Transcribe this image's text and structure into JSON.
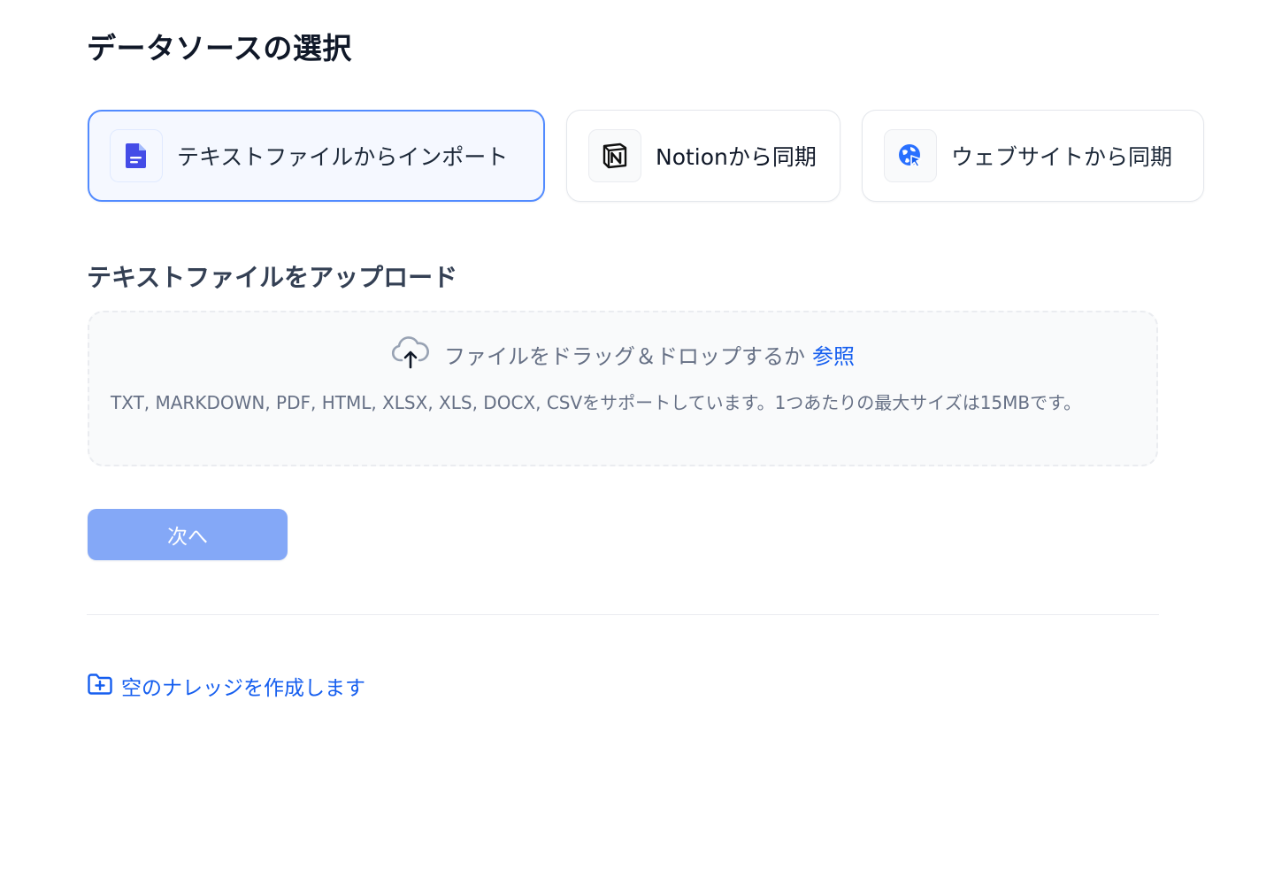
{
  "page": {
    "title": "データソースの選択"
  },
  "sources": {
    "items": [
      {
        "label": "テキストファイルからインポート",
        "icon": "file-text-icon",
        "selected": true
      },
      {
        "label": "Notionから同期",
        "icon": "notion-icon",
        "selected": false
      },
      {
        "label": "ウェブサイトから同期",
        "icon": "globe-icon",
        "selected": false
      }
    ]
  },
  "upload": {
    "section_title": "テキストファイルをアップロード",
    "drop_text": "ファイルをドラッグ＆ドロップするか",
    "browse_link": "参照",
    "hint": "TXT, MARKDOWN, PDF, HTML, XLSX, XLS, DOCX, CSVをサポートしています。1つあたりの最大サイズは15MBです。",
    "icon": "cloud-upload-icon"
  },
  "actions": {
    "next_label": "次へ",
    "create_empty_label": "空のナレッジを作成します",
    "create_empty_icon": "folder-plus-icon"
  },
  "colors": {
    "accent": "#155eef",
    "selected_border": "#528bff",
    "next_button_bg": "#84a8f7",
    "dropzone_bg": "#f9fafb"
  }
}
